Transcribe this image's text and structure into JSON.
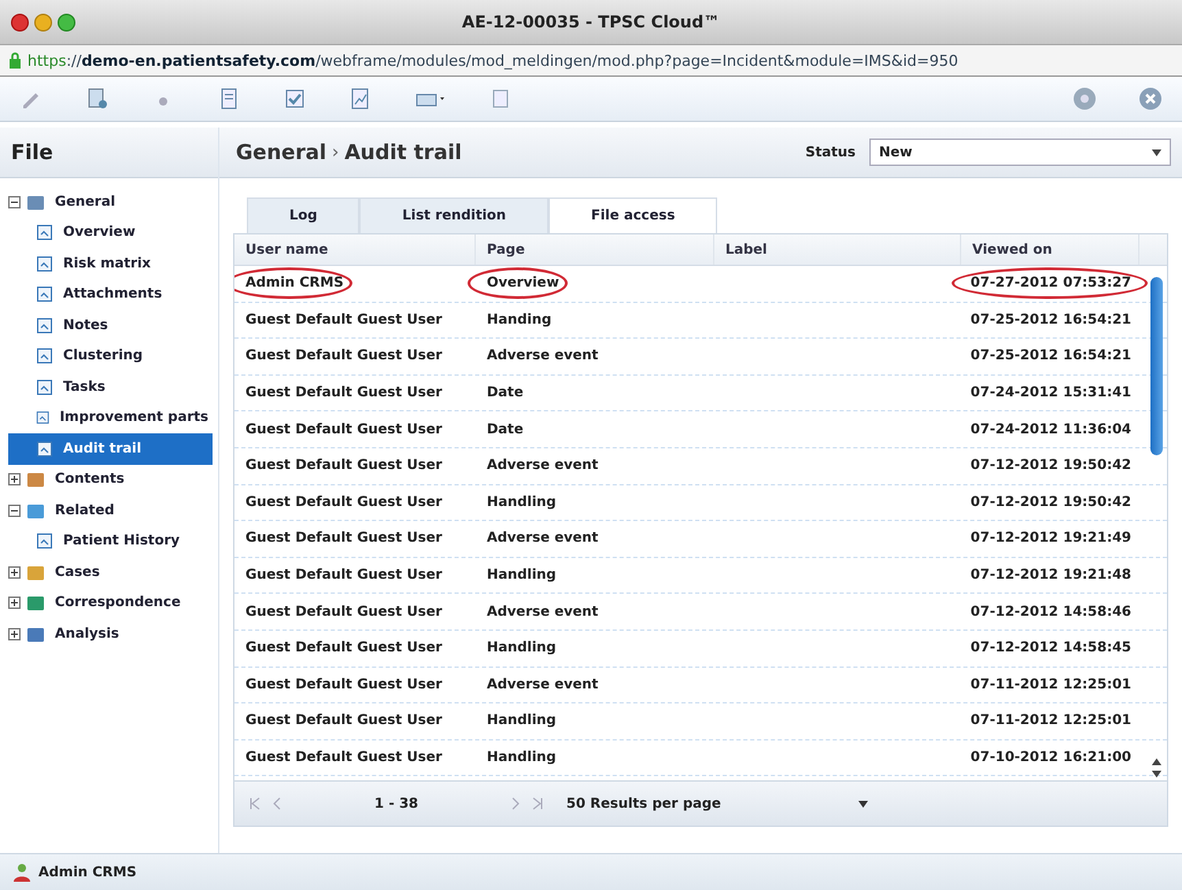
{
  "window": {
    "title": "AE-12-00035 - TPSC Cloud™"
  },
  "address_bar": {
    "scheme": "https",
    "url": "://**demo-en.patientsafety.com**/webframe/modules/mod_meldingen/mod.php?page=Incident&module=IMS&id=950"
  },
  "sidebar": {
    "title": "File",
    "items": [
      {
        "label": "General",
        "expanded": true,
        "selected": false,
        "children": [
          {
            "label": "Overview",
            "selected": false
          },
          {
            "label": "Risk matrix",
            "selected": false
          },
          {
            "label": "Attachments",
            "selected": false
          },
          {
            "label": "Notes",
            "selected": false
          },
          {
            "label": "Clustering",
            "selected": false
          },
          {
            "label": "Tasks",
            "selected": false
          },
          {
            "label": "Improvement parts",
            "selected": false
          },
          {
            "label": "Audit trail",
            "selected": true
          }
        ]
      },
      {
        "label": "Contents",
        "expanded": false,
        "selected": false
      },
      {
        "label": "Related",
        "expanded": true,
        "selected": false,
        "children": [
          {
            "label": "Patient History",
            "selected": false
          }
        ]
      },
      {
        "label": "Cases",
        "expanded": false,
        "selected": false
      },
      {
        "label": "Correspondence",
        "expanded": false,
        "selected": false
      },
      {
        "label": "Analysis",
        "expanded": false,
        "selected": false
      }
    ]
  },
  "header": {
    "breadcrumb": [
      "General",
      "Audit trail"
    ],
    "separator": "›",
    "status_label": "Status",
    "status_value": "New"
  },
  "tabs": [
    {
      "label": "Log",
      "selected": false
    },
    {
      "label": "List rendition",
      "selected": false
    },
    {
      "label": "File access",
      "selected": true
    }
  ],
  "table": {
    "columns": [
      "User name",
      "Page",
      "Label",
      "Viewed on"
    ],
    "rows": [
      {
        "user_name": {
          "text": "Admin CRMS",
          "circled": true
        },
        "page": {
          "text": "Overview",
          "circled": true
        },
        "viewed_on": {
          "text": "07-27-2012 07:53:27",
          "circled": true
        }
      },
      {
        "user_name": {
          "text": "Guest Default Guest User",
          "circled": false
        },
        "page": {
          "text": "Handing",
          "circled": false
        },
        "viewed_on": {
          "text": "07-25-2012 16:54:21",
          "circled": false
        }
      },
      {
        "user_name": {
          "text": "Guest Default Guest User",
          "circled": false
        },
        "page": {
          "text": "Adverse event",
          "circled": false
        },
        "viewed_on": {
          "text": "07-25-2012 16:54:21",
          "circled": false
        }
      },
      {
        "user_name": {
          "text": "Guest Default Guest User",
          "circled": false
        },
        "page": {
          "text": "Date",
          "circled": false
        },
        "viewed_on": {
          "text": "07-24-2012 15:31:41",
          "circled": false
        }
      },
      {
        "user_name": {
          "text": "Guest Default Guest User",
          "circled": false
        },
        "page": {
          "text": "Date",
          "circled": false
        },
        "viewed_on": {
          "text": "07-24-2012 11:36:04",
          "circled": false
        }
      },
      {
        "user_name": {
          "text": "Guest Default Guest User",
          "circled": false
        },
        "page": {
          "text": "Adverse event",
          "circled": false
        },
        "viewed_on": {
          "text": "07-12-2012 19:50:42",
          "circled": false
        }
      },
      {
        "user_name": {
          "text": "Guest Default Guest User",
          "circled": false
        },
        "page": {
          "text": "Handling",
          "circled": false
        },
        "viewed_on": {
          "text": "07-12-2012 19:50:42",
          "circled": false
        }
      },
      {
        "user_name": {
          "text": "Guest Default Guest User",
          "circled": false
        },
        "page": {
          "text": "Adverse event",
          "circled": false
        },
        "viewed_on": {
          "text": "07-12-2012 19:21:49",
          "circled": false
        }
      },
      {
        "user_name": {
          "text": "Guest Default Guest User",
          "circled": false
        },
        "page": {
          "text": "Handling",
          "circled": false
        },
        "viewed_on": {
          "text": "07-12-2012 19:21:48",
          "circled": false
        }
      },
      {
        "user_name": {
          "text": "Guest Default Guest User",
          "circled": false
        },
        "page": {
          "text": "Adverse event",
          "circled": false
        },
        "viewed_on": {
          "text": "07-12-2012 14:58:46",
          "circled": false
        }
      },
      {
        "user_name": {
          "text": "Guest Default Guest User",
          "circled": false
        },
        "page": {
          "text": "Handling",
          "circled": false
        },
        "viewed_on": {
          "text": "07-12-2012 14:58:45",
          "circled": false
        }
      },
      {
        "user_name": {
          "text": "Guest Default Guest User",
          "circled": false
        },
        "page": {
          "text": "Adverse event",
          "circled": false
        },
        "viewed_on": {
          "text": "07-11-2012 12:25:01",
          "circled": false
        }
      },
      {
        "user_name": {
          "text": "Guest Default Guest User",
          "circled": false
        },
        "page": {
          "text": "Handling",
          "circled": false
        },
        "viewed_on": {
          "text": "07-11-2012 12:25:01",
          "circled": false
        }
      },
      {
        "user_name": {
          "text": "Guest Default Guest User",
          "circled": false
        },
        "page": {
          "text": "Handling",
          "circled": false
        },
        "viewed_on": {
          "text": "07-10-2012 16:21:00",
          "circled": false
        }
      }
    ]
  },
  "pager": {
    "range": "1 - 38",
    "per_page": "50 Results per page"
  },
  "status_bar": {
    "user": "Admin CRMS"
  }
}
